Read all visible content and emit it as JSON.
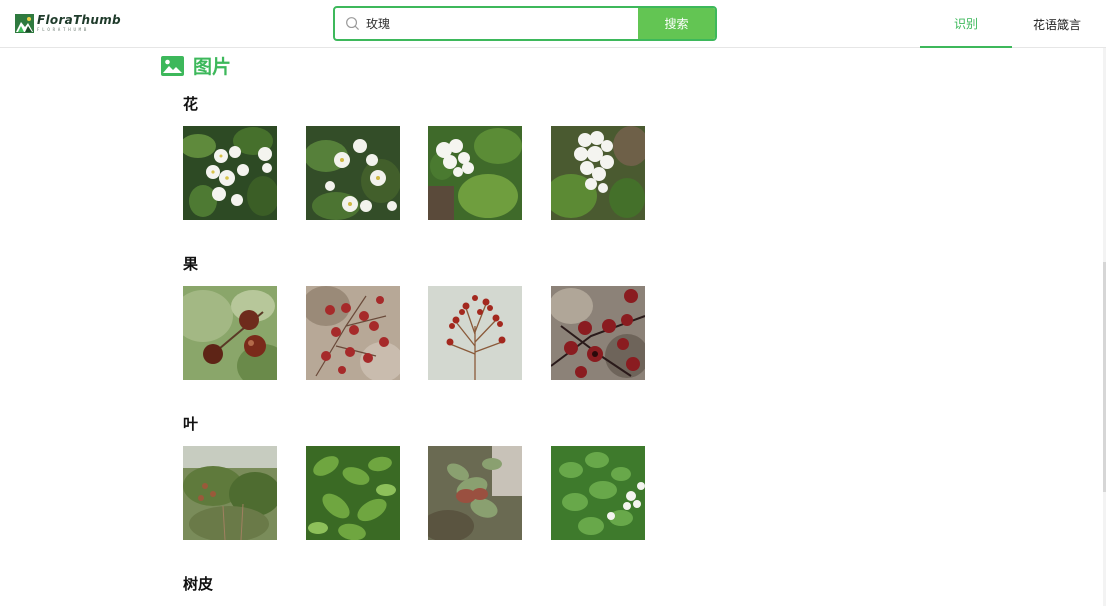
{
  "header": {
    "logo": {
      "name": "FloraThumb",
      "subtitle": "FLORATHUMB"
    },
    "search": {
      "value": "玫瑰",
      "button_label": "搜索"
    },
    "nav": {
      "identify": "识别",
      "flower_language": "花语箴言"
    }
  },
  "section": {
    "title": "图片"
  },
  "groups": [
    {
      "title": "花"
    },
    {
      "title": "果"
    },
    {
      "title": "叶"
    },
    {
      "title": "树皮"
    }
  ],
  "colors": {
    "accent": "#3db85b",
    "button": "#63c553"
  },
  "icons": {
    "logo": "flora-thumb-logo-icon",
    "search": "search-icon",
    "section": "image-icon"
  }
}
